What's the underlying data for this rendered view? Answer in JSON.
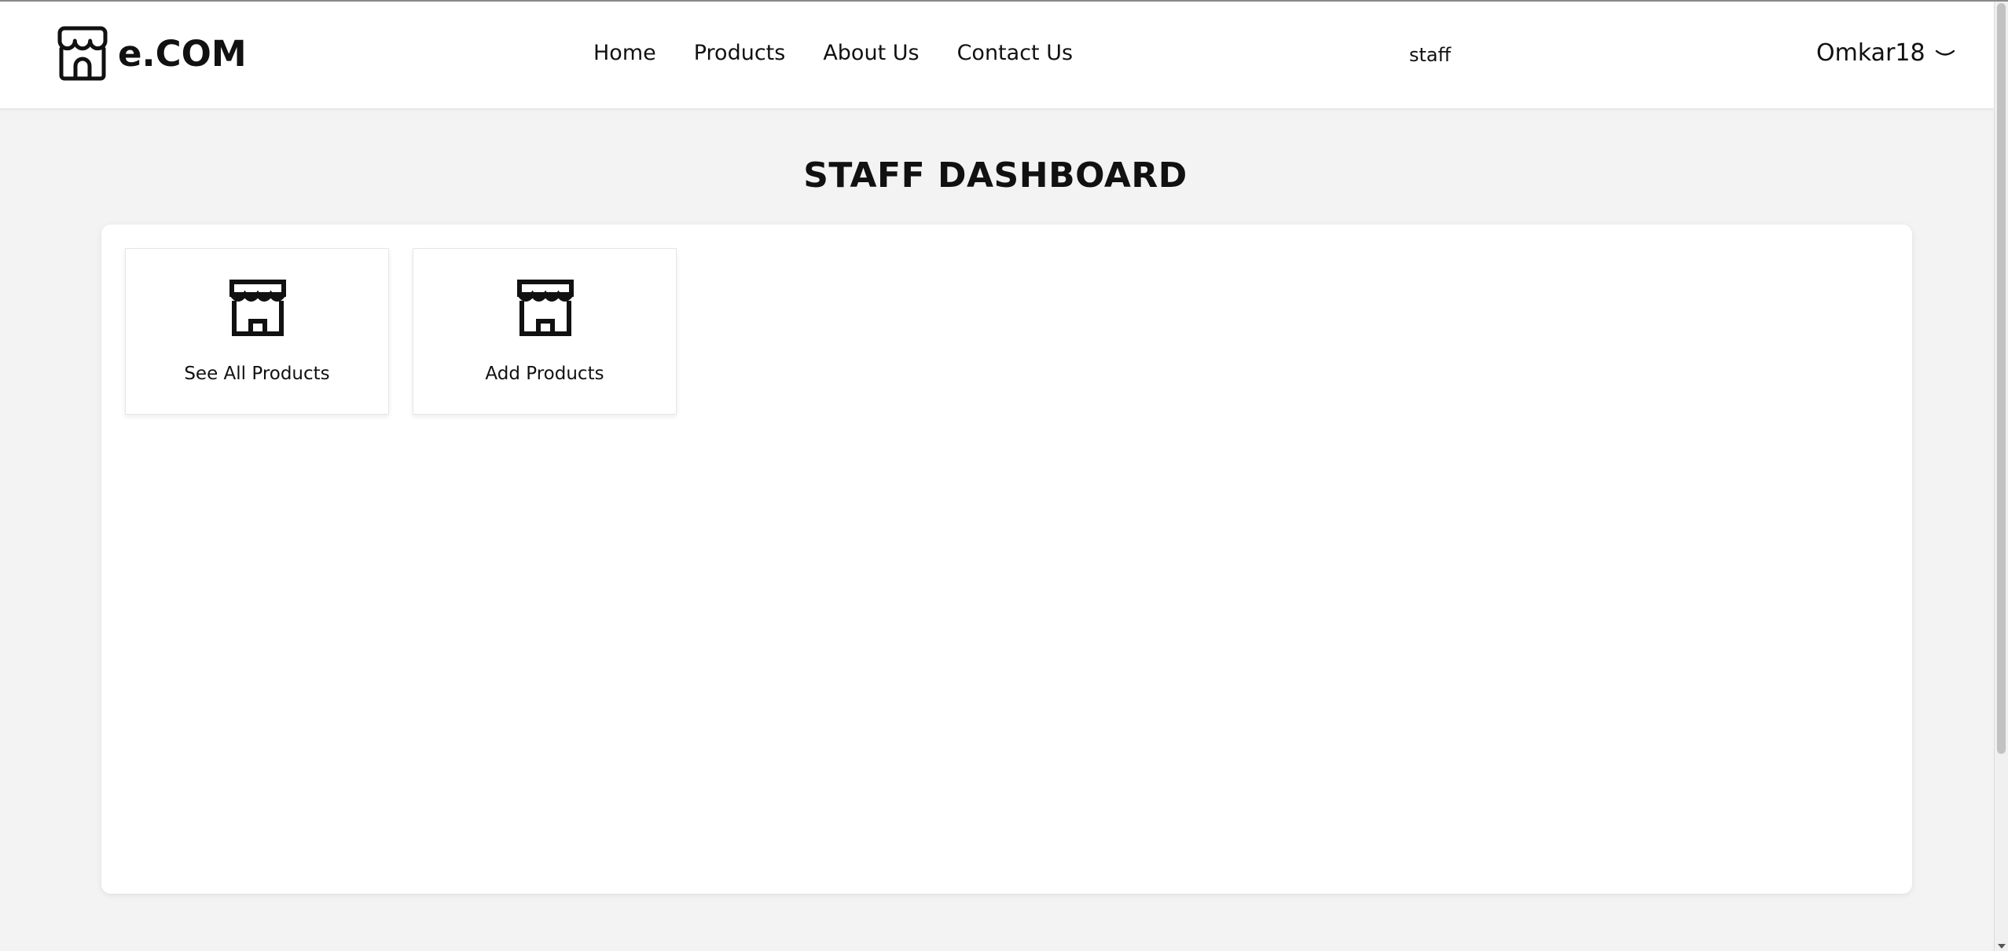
{
  "brand": {
    "name": "e.COM",
    "icon": "store-icon"
  },
  "nav": {
    "items": [
      {
        "label": "Home"
      },
      {
        "label": "Products"
      },
      {
        "label": "About Us"
      },
      {
        "label": "Contact Us"
      }
    ]
  },
  "header": {
    "role": "staff",
    "user": {
      "name": "Omkar18",
      "icon": "chevron-down-icon"
    }
  },
  "main": {
    "title": "STAFF DASHBOARD",
    "cards": [
      {
        "label": "See All Products",
        "icon": "store-icon"
      },
      {
        "label": "Add Products",
        "icon": "store-icon"
      }
    ]
  },
  "colors": {
    "page_background": "#f3f3f3",
    "surface": "#ffffff",
    "text": "#111111"
  }
}
